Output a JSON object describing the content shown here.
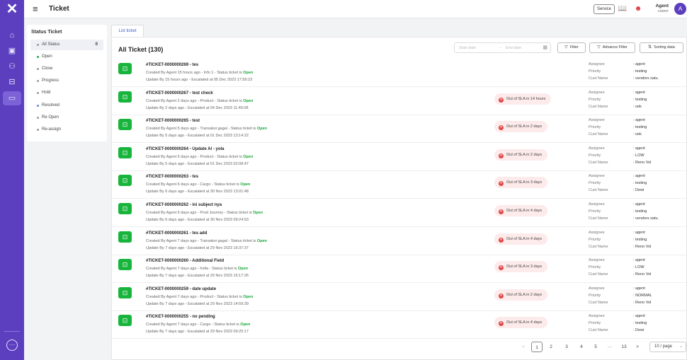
{
  "header": {
    "title": "Ticket",
    "service_label": "Service",
    "agent_name": "Agent",
    "agent_role": "AGENT",
    "avatar_initial": "A"
  },
  "status_panel": {
    "title": "Status Ticket",
    "items": [
      {
        "label": "All Status",
        "count": "0",
        "dot": "#999999"
      },
      {
        "label": "Open",
        "dot": "#18b53c"
      },
      {
        "label": "Close",
        "dot": "#999999"
      },
      {
        "label": "Progress",
        "dot": "#999999"
      },
      {
        "label": "Hold",
        "dot": "#999999"
      },
      {
        "label": "Resolved",
        "dot": "#5b8fd9"
      },
      {
        "label": "Re Open",
        "dot": "#999999"
      },
      {
        "label": "Re-assign",
        "dot": "#999999"
      }
    ]
  },
  "tab": {
    "label": "List ticket"
  },
  "main": {
    "title": "All Ticket (130)",
    "start_date_placeholder": "Start date",
    "end_date_placeholder": "End date",
    "filter_label": "Filter",
    "advance_filter_label": "Advance Filter",
    "sorting_label": "Sorting data"
  },
  "meta_labels": {
    "assignee": "Assignee",
    "priority": "Priority",
    "cust_name": "Cust Name"
  },
  "status_open": "Open",
  "tickets": [
    {
      "name": "#TICKET-0000000269 - tes",
      "created": "Created By Agent 15 hours ago - Info 1 - Status ticket is ",
      "update": "Update By 15 hours ago - Escalated at 05 Dec 2023 17:59:23",
      "sla": "",
      "assignee": ": agent",
      "priority": ": testing",
      "cust": ": vendors satu."
    },
    {
      "name": "#TICKET-0000000267 - test check",
      "created": "Created By Agent 2 days ago - Product - Status ticket is ",
      "update": "Update By 2 days ago - Escalated at 04 Dec 2023 11:45:08",
      "sla": "Out of SLA in 14 hours",
      "assignee": ": agent",
      "priority": ": testing",
      "cust": ": oek"
    },
    {
      "name": "#TICKET-0000000265 - test",
      "created": "Created By Agent 5 days ago - Transaksi gagal - Status ticket is ",
      "update": "Update By 5 days ago - Escalated at 01 Dec 2023 13:14:22",
      "sla": "Out of SLA in 2 days",
      "assignee": ": agent",
      "priority": ": testing",
      "cust": ": oek"
    },
    {
      "name": "#TICKET-0000000264 - Update AI - yola",
      "created": "Created By Agent 5 days ago - Product - Status ticket is ",
      "update": "Update By 5 days ago - Escalated at 01 Dec 2023 02:08:47",
      "sla": "Out of SLA in 2 days",
      "assignee": ": agent",
      "priority": ": LOW",
      "cust": ": Reno Vol"
    },
    {
      "name": "#TICKET-0000000263 - tes",
      "created": "Created By Agent 6 days ago - Cargo - Status ticket is ",
      "update": "Update By 6 days ago - Escalated at 30 Nov 2023 13:01:48",
      "sla": "Out of SLA in 3 days",
      "assignee": ": agent",
      "priority": ": testing",
      "cust": ": Dewi"
    },
    {
      "name": "#TICKET-0000000262 - ini subject nya",
      "created": "Created By Agent 6 days ago - Prod Journey - Status ticket is ",
      "update": "Update By 6 days ago - Escalated at 30 Nov 2023 09:24:53",
      "sla": "Out of SLA in 4 days",
      "assignee": ": agent",
      "priority": ": testing",
      "cust": ": vendors satu."
    },
    {
      "name": "#TICKET-0000000261 - tes add",
      "created": "Created By Agent 7 days ago - Transaksi gagal - Status ticket is ",
      "update": "Update By 7 days ago - Escalated at 29 Nov 2023 16:37:37",
      "sla": "Out of SLA in 4 days",
      "assignee": ": agent",
      "priority": ": testing",
      "cust": ": Reno Vol"
    },
    {
      "name": "#TICKET-0000000260 - Additional Field",
      "created": "Created By Agent 7 days ago - holla - Status ticket is ",
      "update": "Update By 7 days ago - Escalated at 29 Nov 2023 16:17:26",
      "sla": "Out of SLA in 3 days",
      "assignee": ": agent",
      "priority": ": LOW",
      "cust": ": Reno Vol"
    },
    {
      "name": "#TICKET-0000000259 - date update",
      "created": "Created By Agent 7 days ago - Product - Status ticket is ",
      "update": "Update By 7 days ago - Escalated at 29 Nov 2023 14:59:39",
      "sla": "Out of SLA in 2 days",
      "assignee": ": agent",
      "priority": ": NORMAL",
      "cust": ": Reno Vol"
    },
    {
      "name": "#TICKET-0000000255 - no pending",
      "created": "Created By Agent 7 days ago - Cargo - Status ticket is ",
      "update": "Update By 7 days ago - Escalated at 29 Nov 2023 09:25:17",
      "sla": "Out of SLA in 4 days",
      "assignee": ": agent",
      "priority": ": testing",
      "cust": ": Dewi"
    }
  ],
  "pagination": {
    "prev": "<",
    "pages": [
      "1",
      "2",
      "3",
      "4",
      "5",
      "···",
      "13"
    ],
    "next": ">",
    "page_size": "10 / page"
  }
}
